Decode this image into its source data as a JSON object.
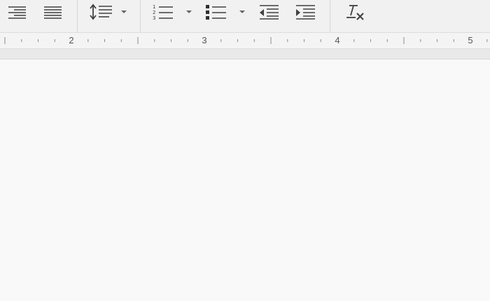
{
  "toolbar": {
    "buttons": [
      {
        "name": "align-right-button",
        "icon": "align-right-icon"
      },
      {
        "name": "justify-button",
        "icon": "justify-icon"
      },
      {
        "name": "line-spacing-button",
        "icon": "line-spacing-icon"
      },
      {
        "name": "numbered-list-button",
        "icon": "numbered-list-icon"
      },
      {
        "name": "bulleted-list-button",
        "icon": "bulleted-list-icon"
      },
      {
        "name": "decrease-indent-button",
        "icon": "decrease-indent-icon"
      },
      {
        "name": "increase-indent-button",
        "icon": "increase-indent-icon"
      },
      {
        "name": "clear-formatting-button",
        "icon": "clear-formatting-icon"
      }
    ]
  },
  "ruler": {
    "numbers": [
      "2",
      "3",
      "4",
      "5"
    ]
  },
  "colors": {
    "icon": "#404040",
    "toolbar_bg": "#f1f1f1",
    "page_bg": "#f9f9f9"
  }
}
